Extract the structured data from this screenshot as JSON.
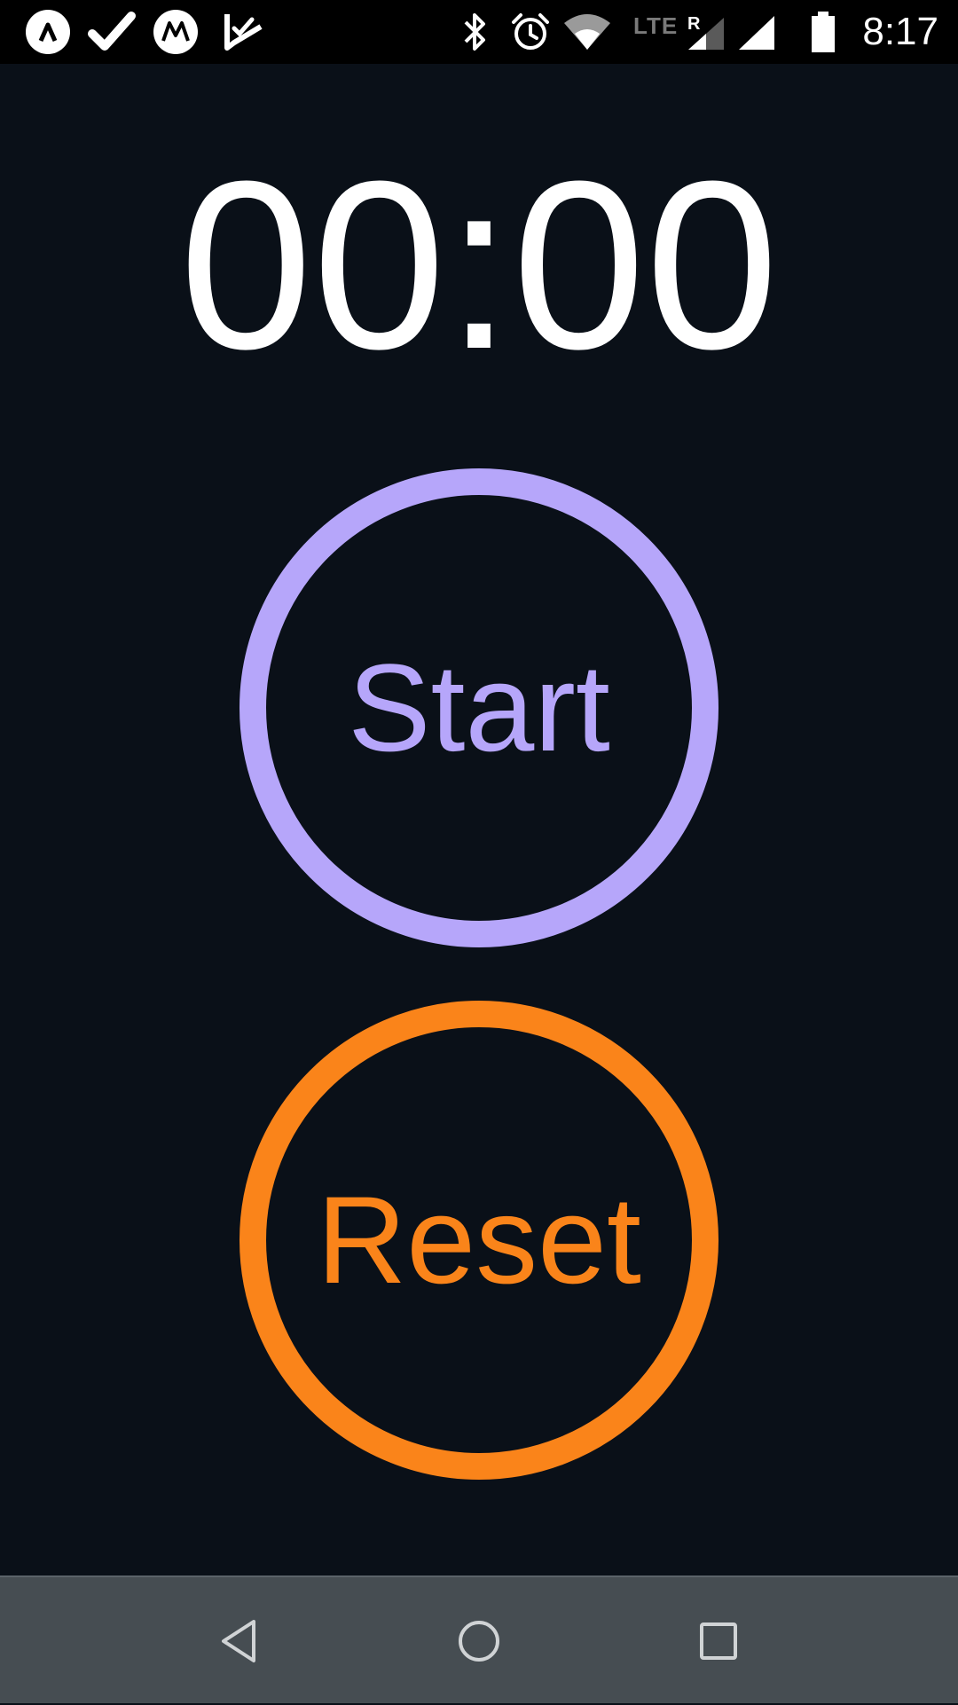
{
  "status_bar": {
    "time": "8:17",
    "network_label": "LTE",
    "roaming_label": "R",
    "left_icons": [
      "arrow-app-icon",
      "check-icon",
      "motorola-icon",
      "checklist-icon"
    ],
    "right_icons": [
      "bluetooth-icon",
      "alarm-icon",
      "wifi-icon",
      "signal-roaming-icon",
      "signal-icon",
      "battery-icon"
    ]
  },
  "stopwatch": {
    "time": "00:00",
    "start_label": "Start",
    "reset_label": "Reset"
  },
  "colors": {
    "background": "#0a1018",
    "start_accent": "#b6a6fa",
    "reset_accent": "#fa841a",
    "nav_bar": "#464d52"
  },
  "nav_bar": {
    "buttons": [
      "back-icon",
      "home-icon",
      "recents-icon"
    ]
  }
}
